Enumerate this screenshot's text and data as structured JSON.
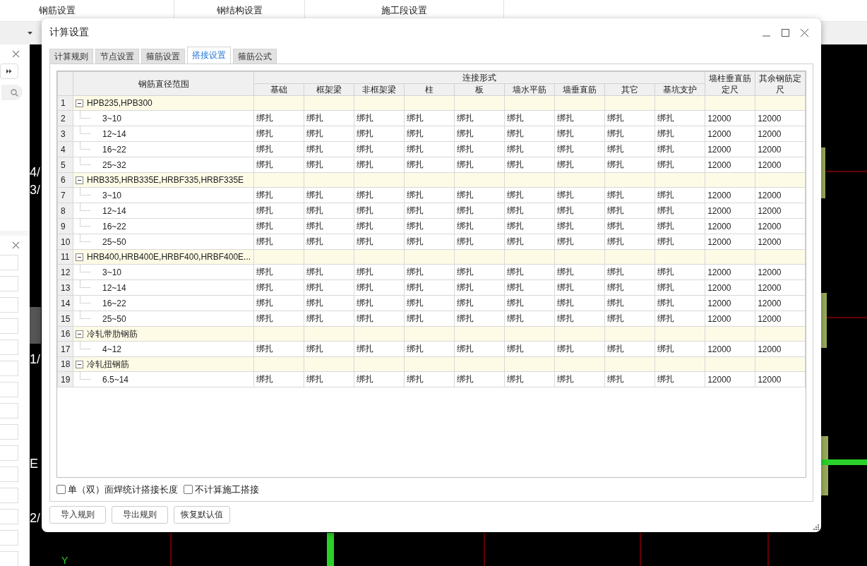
{
  "top_tabs": [
    "钢筋设置",
    "钢结构设置",
    "施工段设置"
  ],
  "canvas": {
    "axis_labels": [
      "4/",
      "3/",
      "1/",
      "E",
      "2/"
    ],
    "y_axis": "Y"
  },
  "dialog": {
    "title": "计算设置",
    "tabs": [
      {
        "label": "计算规则",
        "selected": false
      },
      {
        "label": "节点设置",
        "selected": false
      },
      {
        "label": "箍筋设置",
        "selected": false
      },
      {
        "label": "搭接设置",
        "selected": true
      },
      {
        "label": "箍筋公式",
        "selected": false
      }
    ],
    "table": {
      "range_header": "钢筋直径范围",
      "group_header": "连接形式",
      "connection_columns": [
        "基础",
        "框架梁",
        "非框架梁",
        "柱",
        "板",
        "墙水平筋",
        "墙垂直筋",
        "其它",
        "基坑支护"
      ],
      "extra_columns": [
        "墙柱垂直筋定尺",
        "其余钢筋定尺"
      ],
      "groups": [
        {
          "num": "1",
          "label": "HPB235,HPB300",
          "expanded": true,
          "children": [
            {
              "num": "2",
              "range": "3~10",
              "cells": [
                "绑扎",
                "绑扎",
                "绑扎",
                "绑扎",
                "绑扎",
                "绑扎",
                "绑扎",
                "绑扎",
                "绑扎",
                "12000",
                "12000"
              ]
            },
            {
              "num": "3",
              "range": "12~14",
              "cells": [
                "绑扎",
                "绑扎",
                "绑扎",
                "绑扎",
                "绑扎",
                "绑扎",
                "绑扎",
                "绑扎",
                "绑扎",
                "12000",
                "12000"
              ]
            },
            {
              "num": "4",
              "range": "16~22",
              "cells": [
                "绑扎",
                "绑扎",
                "绑扎",
                "绑扎",
                "绑扎",
                "绑扎",
                "绑扎",
                "绑扎",
                "绑扎",
                "12000",
                "12000"
              ]
            },
            {
              "num": "5",
              "range": "25~32",
              "cells": [
                "绑扎",
                "绑扎",
                "绑扎",
                "绑扎",
                "绑扎",
                "绑扎",
                "绑扎",
                "绑扎",
                "绑扎",
                "12000",
                "12000"
              ]
            }
          ]
        },
        {
          "num": "6",
          "label": "HRB335,HRB335E,HRBF335,HRBF335E",
          "expanded": true,
          "children": [
            {
              "num": "7",
              "range": "3~10",
              "cells": [
                "绑扎",
                "绑扎",
                "绑扎",
                "绑扎",
                "绑扎",
                "绑扎",
                "绑扎",
                "绑扎",
                "绑扎",
                "12000",
                "12000"
              ]
            },
            {
              "num": "8",
              "range": "12~14",
              "cells": [
                "绑扎",
                "绑扎",
                "绑扎",
                "绑扎",
                "绑扎",
                "绑扎",
                "绑扎",
                "绑扎",
                "绑扎",
                "12000",
                "12000"
              ]
            },
            {
              "num": "9",
              "range": "16~22",
              "cells": [
                "绑扎",
                "绑扎",
                "绑扎",
                "绑扎",
                "绑扎",
                "绑扎",
                "绑扎",
                "绑扎",
                "绑扎",
                "12000",
                "12000"
              ]
            },
            {
              "num": "10",
              "range": "25~50",
              "cells": [
                "绑扎",
                "绑扎",
                "绑扎",
                "绑扎",
                "绑扎",
                "绑扎",
                "绑扎",
                "绑扎",
                "绑扎",
                "12000",
                "12000"
              ]
            }
          ]
        },
        {
          "num": "11",
          "label": "HRB400,HRB400E,HRBF400,HRBF400E...",
          "expanded": true,
          "children": [
            {
              "num": "12",
              "range": "3~10",
              "cells": [
                "绑扎",
                "绑扎",
                "绑扎",
                "绑扎",
                "绑扎",
                "绑扎",
                "绑扎",
                "绑扎",
                "绑扎",
                "12000",
                "12000"
              ]
            },
            {
              "num": "13",
              "range": "12~14",
              "cells": [
                "绑扎",
                "绑扎",
                "绑扎",
                "绑扎",
                "绑扎",
                "绑扎",
                "绑扎",
                "绑扎",
                "绑扎",
                "12000",
                "12000"
              ]
            },
            {
              "num": "14",
              "range": "16~22",
              "cells": [
                "绑扎",
                "绑扎",
                "绑扎",
                "绑扎",
                "绑扎",
                "绑扎",
                "绑扎",
                "绑扎",
                "绑扎",
                "12000",
                "12000"
              ]
            },
            {
              "num": "15",
              "range": "25~50",
              "cells": [
                "绑扎",
                "绑扎",
                "绑扎",
                "绑扎",
                "绑扎",
                "绑扎",
                "绑扎",
                "绑扎",
                "绑扎",
                "12000",
                "12000"
              ]
            }
          ]
        },
        {
          "num": "16",
          "label": "冷轧带肋钢筋",
          "expanded": true,
          "children": [
            {
              "num": "17",
              "range": "4~12",
              "cells": [
                "绑扎",
                "绑扎",
                "绑扎",
                "绑扎",
                "绑扎",
                "绑扎",
                "绑扎",
                "绑扎",
                "绑扎",
                "12000",
                "12000"
              ]
            }
          ]
        },
        {
          "num": "18",
          "label": "冷轧扭钢筋",
          "expanded": true,
          "children": [
            {
              "num": "19",
              "range": "6.5~14",
              "cells": [
                "绑扎",
                "绑扎",
                "绑扎",
                "绑扎",
                "绑扎",
                "绑扎",
                "绑扎",
                "绑扎",
                "绑扎",
                "12000",
                "12000"
              ]
            }
          ]
        }
      ]
    },
    "options": [
      {
        "label": "单（双）面焊统计搭接长度",
        "checked": false
      },
      {
        "label": "不计算施工搭接",
        "checked": false
      }
    ],
    "buttons": [
      "导入规则",
      "导出规则",
      "恢复默认值"
    ]
  }
}
